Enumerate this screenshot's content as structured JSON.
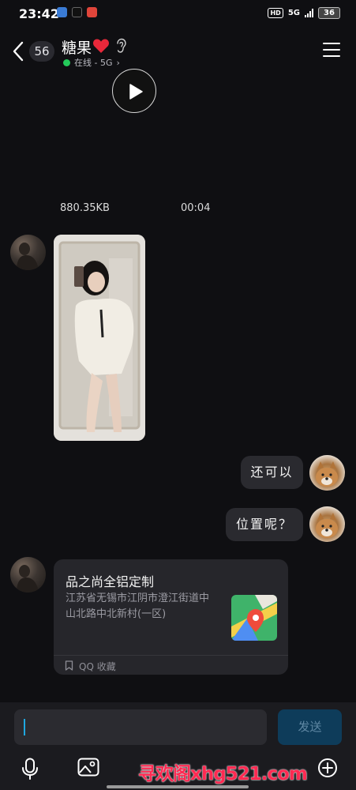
{
  "status_bar": {
    "time": "23:42",
    "hd": "HD",
    "network": "5G",
    "battery": "36"
  },
  "header": {
    "unread_count": "56",
    "contact_name": "糖果",
    "status_text": "在线 - 5G",
    "status_arrow": "›"
  },
  "messages": {
    "video": {
      "size": "880.35KB",
      "duration": "00:04"
    },
    "bubble_1": "还可以",
    "bubble_2": "位置呢？",
    "location": {
      "title": "品之尚全铝定制",
      "address": "江苏省无锡市江阴市澄江街道中山北路中北新村(一区)",
      "source": "QQ 收藏"
    }
  },
  "input": {
    "placeholder": "",
    "send_label": "发送"
  },
  "watermark": "寻欢阁xhg521.com",
  "colors": {
    "background": "#0f0f12",
    "bubble": "#2a2a2f",
    "online": "#24c95a",
    "send_button": "#0e3c5a",
    "watermark": "#ff2a52"
  },
  "icons": [
    "back-icon",
    "heart-icon",
    "ear-icon",
    "menu-icon",
    "play-icon",
    "map-icon",
    "bookmark-icon",
    "microphone-icon",
    "image-icon",
    "plus-icon"
  ]
}
